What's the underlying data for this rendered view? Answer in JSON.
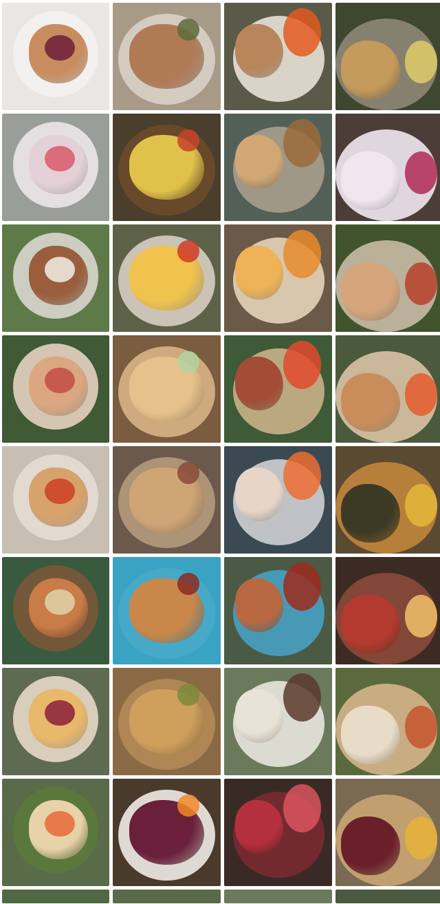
{
  "gallery": {
    "tiles": [
      {
        "bg": "#e9e6e3",
        "plate": "#f4f2f0",
        "food": "#c98c5e",
        "accent": "#6b1f3a"
      },
      {
        "bg": "#a79b88",
        "plate": "#d9d2c6",
        "food": "#b07a55",
        "accent": "#5e6b3b"
      },
      {
        "bg": "#5a5a48",
        "plate": "#e7e1d6",
        "food": "#b9855a",
        "accent": "#e25b1e"
      },
      {
        "bg": "#3e4730",
        "plate": "#8e8775",
        "food": "#c59b5c",
        "accent": "#e0cc68"
      },
      {
        "bg": "#9a9e9b",
        "plate": "#ece7ea",
        "food": "#e4d1d7",
        "accent": "#d95a6b"
      },
      {
        "bg": "#4a3e2c",
        "plate": "#6b4a2a",
        "food": "#e0c24b",
        "accent": "#c6432b"
      },
      {
        "bg": "#536058",
        "plate": "#a89e8c",
        "food": "#d2a774",
        "accent": "#9a6a3a"
      },
      {
        "bg": "#4c3d39",
        "plate": "#efe8ef",
        "food": "#f2e6ee",
        "accent": "#b22a58"
      },
      {
        "bg": "#5e7a48",
        "plate": "#d9d6cf",
        "food": "#9a5e3d",
        "accent": "#f2efe8"
      },
      {
        "bg": "#5d6148",
        "plate": "#d7cfc2",
        "food": "#f0c24e",
        "accent": "#d13b24"
      },
      {
        "bg": "#6b5a48",
        "plate": "#e4d2b8",
        "food": "#efb257",
        "accent": "#e88b2b"
      },
      {
        "bg": "#41542d",
        "plate": "#c9bba6",
        "food": "#d6a57c",
        "accent": "#b7412c"
      },
      {
        "bg": "#3f5a35",
        "plate": "#e4d2c0",
        "food": "#dba781",
        "accent": "#c24c45"
      },
      {
        "bg": "#7a5c3e",
        "plate": "#d7b285",
        "food": "#e6c18b",
        "accent": "#b4d2a0"
      },
      {
        "bg": "#3e5a36",
        "plate": "#c8b08a",
        "food": "#a34c36",
        "accent": "#e04a2c"
      },
      {
        "bg": "#4c5a3c",
        "plate": "#d9c2a4",
        "food": "#c98d5b",
        "accent": "#e45a2e"
      },
      {
        "bg": "#c7bfb4",
        "plate": "#e4ddd4",
        "food": "#d7a26b",
        "accent": "#cc3f22"
      },
      {
        "bg": "#6b5a4c",
        "plate": "#b59a7c",
        "food": "#d0a575",
        "accent": "#8a4a3a"
      },
      {
        "bg": "#3b4a52",
        "plate": "#cfd0d2",
        "food": "#e7d6c8",
        "accent": "#ef6d33"
      },
      {
        "bg": "#5b4a32",
        "plate": "#c0863b",
        "food": "#3c3a25",
        "accent": "#e5b83a"
      },
      {
        "bg": "#3a5a40",
        "plate": "#7a5638",
        "food": "#c97b48",
        "accent": "#e0d3a8"
      },
      {
        "bg": "#3aa3c4",
        "plate": "#48aac9",
        "food": "#c9874a",
        "accent": "#8a2b20"
      },
      {
        "bg": "#4a5a45",
        "plate": "#48a0c2",
        "food": "#b96942",
        "accent": "#9c2b1d"
      },
      {
        "bg": "#3c2b22",
        "plate": "#8a4a3a",
        "food": "#b33a2f",
        "accent": "#f2c26a"
      },
      {
        "bg": "#5e6b52",
        "plate": "#e6d9c7",
        "food": "#e8b86b",
        "accent": "#8a1e3a"
      },
      {
        "bg": "#8a6a45",
        "plate": "#b28a55",
        "food": "#cf9f5c",
        "accent": "#7c8a3a"
      },
      {
        "bg": "#6a7a5a",
        "plate": "#e9e5df",
        "food": "#e9e2d6",
        "accent": "#5a3a2a"
      },
      {
        "bg": "#5a6a3c",
        "plate": "#d4b48a",
        "food": "#e8dcc7",
        "accent": "#c7552b"
      },
      {
        "bg": "#5a6b4a",
        "plate": "#5a7a3a",
        "food": "#e8d2a8",
        "accent": "#e76a3a"
      },
      {
        "bg": "#4a3a2c",
        "plate": "#f0ebe6",
        "food": "#6a1f3a",
        "accent": "#f28a2a"
      },
      {
        "bg": "#3a2a25",
        "plate": "#7a2a30",
        "food": "#b5303e",
        "accent": "#d9545e"
      },
      {
        "bg": "#7a6a52",
        "plate": "#c9a572",
        "food": "#6a1f2a",
        "accent": "#e8b23a"
      }
    ],
    "partial_row": [
      {
        "bg": "#4f6a42"
      },
      {
        "bg": "#5a6a48"
      },
      {
        "bg": "#6a7a5a"
      },
      {
        "bg": "#4a5a40"
      }
    ]
  }
}
